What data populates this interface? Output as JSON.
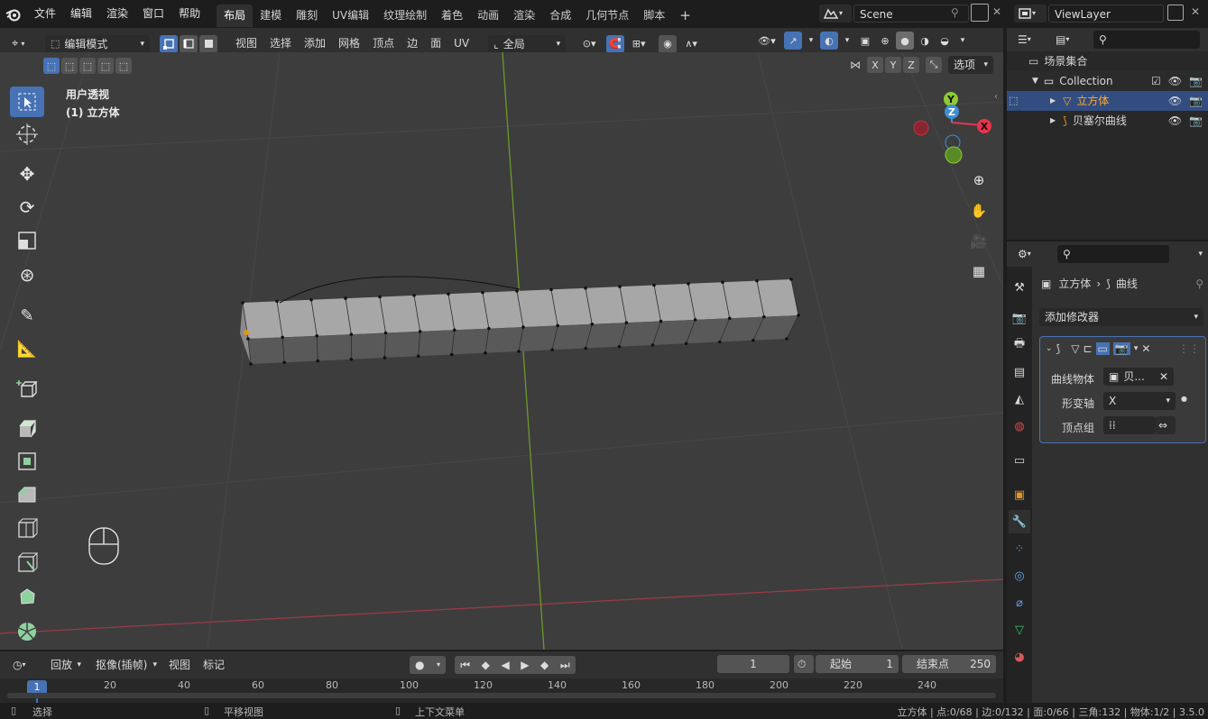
{
  "topbar": {
    "menus": [
      "文件",
      "编辑",
      "渲染",
      "窗口",
      "帮助"
    ],
    "workspaces": [
      "布局",
      "建模",
      "雕刻",
      "UV编辑",
      "纹理绘制",
      "着色",
      "动画",
      "渲染",
      "合成",
      "几何节点",
      "脚本"
    ],
    "active_workspace": "布局",
    "add_workspace": "+",
    "scene_name": "Scene",
    "view_layer": "ViewLayer"
  },
  "viewport_header": {
    "mode": "编辑模式",
    "menus": [
      "视图",
      "选择",
      "添加",
      "网格",
      "顶点",
      "边",
      "面",
      "UV"
    ],
    "transform_orientation": "全局",
    "axes": [
      "X",
      "Y",
      "Z"
    ],
    "options": "选项"
  },
  "viewport": {
    "view_name": "用户透视",
    "object_name": "(1) 立方体",
    "gizmo": {
      "x": "X",
      "y": "Y",
      "z": "Z"
    }
  },
  "outliner": {
    "root": "场景集合",
    "collection": "Collection",
    "items": [
      {
        "name": "立方体",
        "selected": true,
        "icon": "mesh-icon"
      },
      {
        "name": "贝塞尔曲线",
        "selected": false,
        "icon": "curve-icon"
      }
    ]
  },
  "properties": {
    "breadcrumb_object": "立方体",
    "breadcrumb_modifier": "曲线",
    "add_modifier": "添加修改器",
    "modifier": {
      "curve_object_label": "曲线物体",
      "curve_object_value": "贝...",
      "deform_axis_label": "形变轴",
      "deform_axis_value": "X",
      "vertex_group_label": "顶点组"
    }
  },
  "timeline": {
    "playback": "回放",
    "keying": "抠像(插帧)",
    "view": "视图",
    "marker": "标记",
    "current_frame": "1",
    "start_label": "起始",
    "start_value": "1",
    "end_label": "结束点",
    "end_value": "250",
    "ruler": [
      "1",
      "20",
      "40",
      "60",
      "80",
      "100",
      "120",
      "140",
      "160",
      "180",
      "200",
      "220",
      "240"
    ]
  },
  "statusbar": {
    "select": "选择",
    "pan": "平移视图",
    "context_menu": "上下文菜单",
    "stats": "立方体 | 点:0/68 | 边:0/132 | 面:0/66 | 三角:132 | 物体:1/2 | 3.5.0"
  },
  "colors": {
    "accent": "#4772b3",
    "x_axis": "#e8344a",
    "y_axis": "#8ecc2f",
    "z_axis": "#3d8fd6",
    "selected_text": "#ffa82e"
  }
}
